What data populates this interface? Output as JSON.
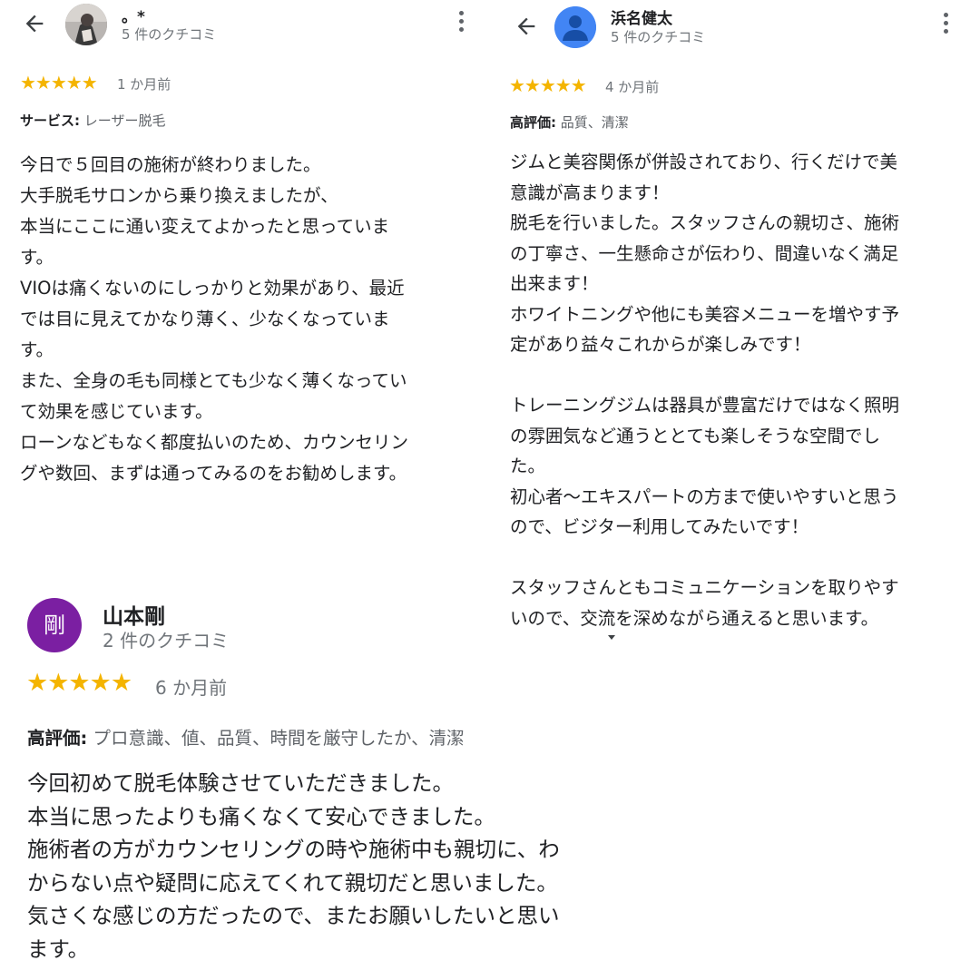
{
  "colors": {
    "star": "#f4b400",
    "muted": "#70757a",
    "text": "#202124",
    "purple_avatar": "#7b1fa2",
    "blue_avatar": "#4285f4"
  },
  "review1": {
    "name": "。*",
    "count": "5 件のクチコミ",
    "stars": "★★★★★",
    "rating": 5,
    "when": "1 か月前",
    "highlight_label": "サービス:",
    "highlight_value": " レーザー脱毛",
    "lines": [
      "今日で５回目の施術が終わりました。",
      "大手脱毛サロンから乗り換えましたが、",
      "本当にここに通い変えてよかったと思っていま",
      "す。",
      "VIOは痛くないのにしっかりと効果があり、最近",
      "では目に見えてかなり薄く、少なくなっていま",
      "す。",
      "また、全身の毛も同様とても少なく薄くなってい",
      "て効果を感じています。",
      "ローンなどもなく都度払いのため、カウンセリン",
      "グや数回、まずは通ってみるのをお勧めします。"
    ]
  },
  "review2": {
    "name": "浜名健太",
    "count": "5 件のクチコミ",
    "stars": "★★★★★",
    "rating": 5,
    "when": "4 か月前",
    "highlight_label": "高評価:",
    "highlight_value": " 品質、清潔",
    "lines": [
      "ジムと美容関係が併設されており、行くだけで美",
      "意識が高まります！",
      "脱毛を行いました。スタッフさんの親切さ、施術",
      "の丁寧さ、一生懸命さが伝わり、間違いなく満足",
      "出来ます！",
      "ホワイトニングや他にも美容メニューを増やす予",
      "定があり益々これからが楽しみです！",
      "",
      "トレーニングジムは器具が豊富だけではなく照明",
      "の雰囲気など通うととても楽しそうな空間でし",
      "た。",
      "初心者〜エキスパートの方まで使いやすいと思う",
      "ので、ビジター利用してみたいです！",
      "",
      "スタッフさんともコミュニケーションを取りやす",
      "いので、交流を深めながら通えると思います。"
    ]
  },
  "review3": {
    "avatar_letter": "剛",
    "name": "山本剛",
    "count": "2 件のクチコミ",
    "stars": "★★★★★",
    "rating": 5,
    "when": "6 か月前",
    "highlight_label": "高評価:",
    "highlight_value": " プロ意識、値、品質、時間を厳守したか、清潔",
    "lines": [
      "今回初めて脱毛体験させていただきました。",
      "本当に思ったよりも痛くなくて安心できました。",
      "施術者の方がカウンセリングの時や施術中も親切に、わ",
      "からない点や疑問に応えてくれて親切だと思いました。",
      "気さくな感じの方だったので、またお願いしたいと思い",
      "ます。"
    ]
  }
}
